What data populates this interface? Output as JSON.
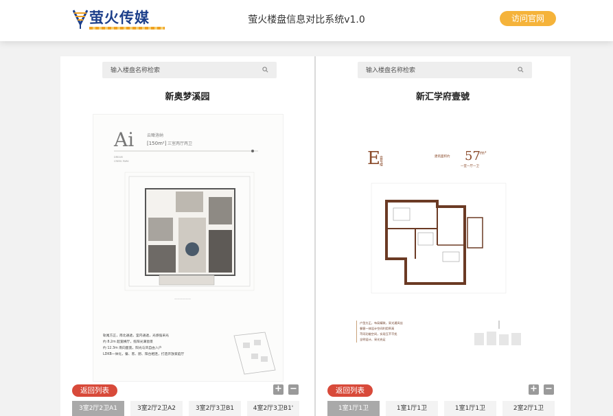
{
  "header": {
    "logo_text": "萤火传媒",
    "title": "萤火楼盘信息对比系统v1.0",
    "visit_label": "访问官网"
  },
  "colors": {
    "accent": "#f5b33a",
    "back_button": "#d84a3a",
    "brand": "#1c3f8a"
  },
  "panels": [
    {
      "search_placeholder": "输入楼盘名称检索",
      "property_name": "新奥梦溪园",
      "plan": {
        "type_code": "Ai",
        "type_title": "云瞰洛納",
        "area": "[150m²]",
        "layout": "三室两厅两卫",
        "brand_en_1": "DREAM",
        "brand_en_2": "CREEK PARK",
        "notes": [
          "轨尾方正，南北通透，室内通透，光感强采光",
          "约 8.2m 超宽横厅，揽阳光满窗景",
          "约 12.3m 南向面宽，阳光与风自由入户",
          "LDKB一体化，餐、客、厨、阳台相连，打造开放家庭厅"
        ]
      },
      "back_label": "返回列表",
      "zoom_in": "+",
      "zoom_out": "−",
      "units": [
        "3室2厅2卫A1",
        "3室2厅2卫A2",
        "3室2厅3卫B1",
        "4室2厅3卫B1'"
      ],
      "active_unit": 0
    },
    {
      "search_placeholder": "输入楼盘名称检索",
      "property_name": "新汇学府壹號",
      "plan": {
        "type_code": "E",
        "type_vertical": "壹号楼",
        "area_prefix": "建筑面积约",
        "area_value": "57",
        "area_unit": "m²",
        "layout": "一室一厅一卫",
        "notes": [
          "户型方正，布局精致，采光通风佳",
          "餐客一体设计空间利用率高",
          "不同功能空间，实现互不干扰",
          "全明设计，采光充足"
        ]
      },
      "back_label": "返回列表",
      "zoom_in": "+",
      "zoom_out": "−",
      "units": [
        "1室1厅1卫",
        "1室1厅1卫",
        "1室1厅1卫",
        "2室2厅1卫"
      ],
      "active_unit": 0
    }
  ]
}
